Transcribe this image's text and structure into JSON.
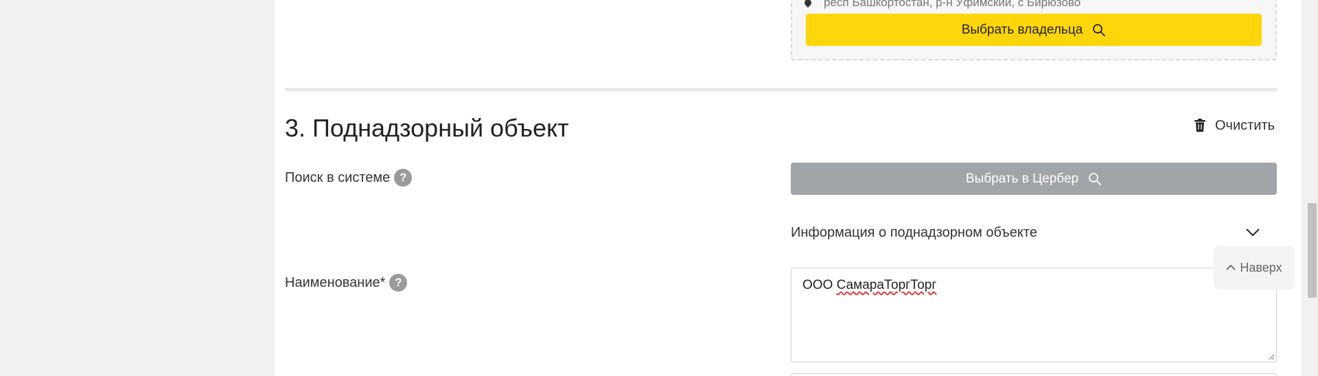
{
  "owner": {
    "address": "респ Башкортостан, р-н Уфимский, с Бирюзово",
    "select_button": "Выбрать владельца"
  },
  "section": {
    "title": "3. Поднадзорный объект",
    "clear_label": "Очистить"
  },
  "search": {
    "label": "Поиск в системе",
    "help": "?",
    "button": "Выбрать в Цербер"
  },
  "info": {
    "label": "Информация о поднадзорном объекте"
  },
  "name": {
    "label": "Наименование*",
    "help": "?",
    "value_prefix": "ООО ",
    "value_misspelled": "СамараТоргТорг"
  },
  "to_top": {
    "label": "Наверх"
  },
  "colors": {
    "accent": "#ffd60a",
    "disabled_button": "#a1a4a9"
  },
  "icons": [
    "map-pin-icon",
    "search-icon",
    "trash-icon",
    "help-icon",
    "chevron-down-icon",
    "chevron-up-icon"
  ]
}
